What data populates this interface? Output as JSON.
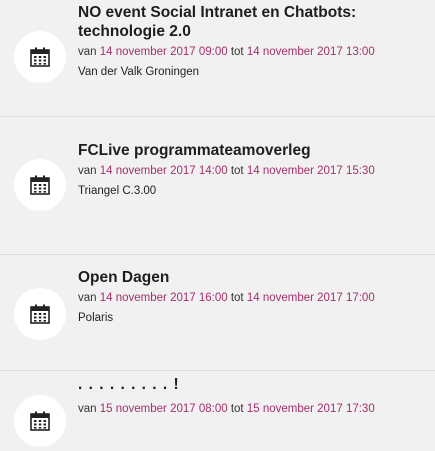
{
  "events": [
    {
      "title": "NO event Social Intranet en Chatbots: technologie 2.0",
      "prefix": "van",
      "start": "14 november 2017 09:00",
      "middle": "tot",
      "end": "14 november 2017 13:00",
      "location": "Van der Valk Groningen"
    },
    {
      "title": "FCLive programmateamoverleg",
      "prefix": "van",
      "start": "14 november 2017 14:00",
      "middle": "tot",
      "end": "14 november 2017 15:30",
      "location": "Triangel C.3.00"
    },
    {
      "title": "Open Dagen",
      "prefix": "van",
      "start": "14 november 2017 16:00",
      "middle": "tot",
      "end": "14 november 2017 17:00",
      "location": "Polaris"
    },
    {
      "title": ". . . . . . . . . !",
      "prefix": "van",
      "start": "15 november 2017 08:00",
      "middle": "tot",
      "end": "15 november 2017 17:30",
      "location": ""
    }
  ],
  "icons": {
    "event_icon": "calendar-icon"
  },
  "colors": {
    "date_accent": "#a2306b",
    "background": "#f1f1f1"
  }
}
